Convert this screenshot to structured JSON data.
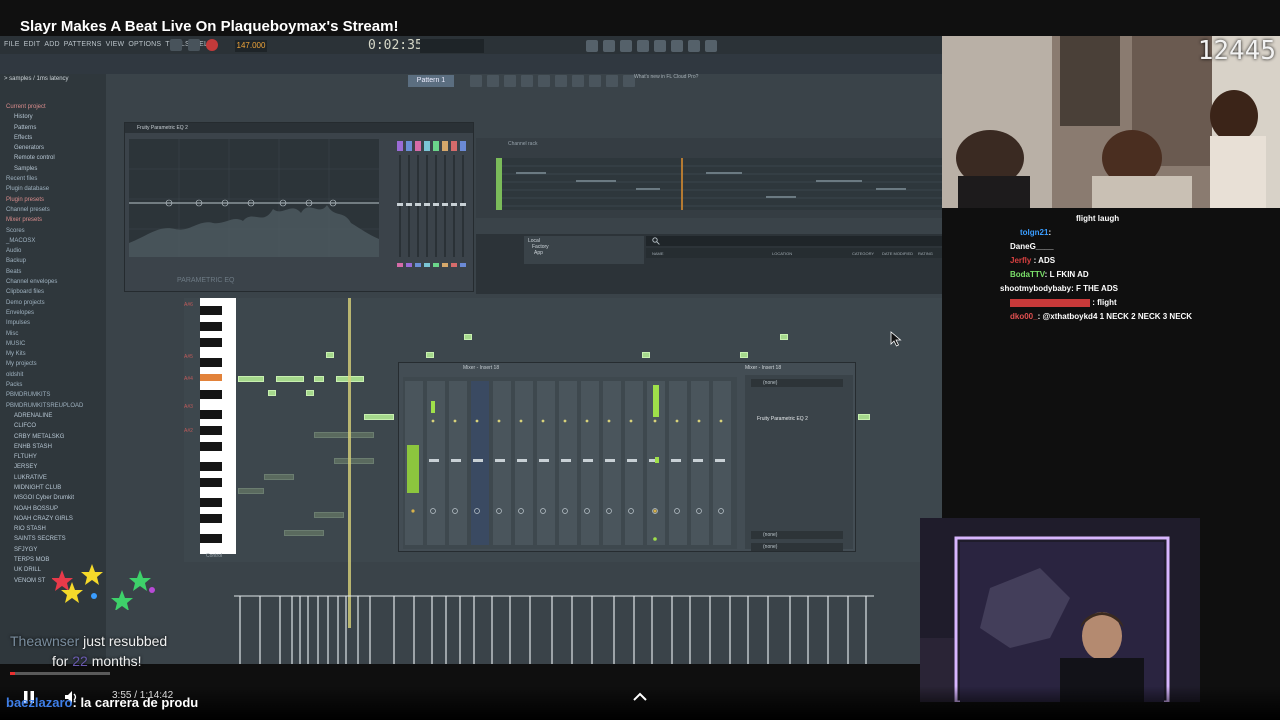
{
  "stream": {
    "title": "Slayr Makes A Beat Live On Plaqueboymax's Stream!",
    "viewer_counter": "12445"
  },
  "fl_studio": {
    "menus": [
      "FILE",
      "EDIT",
      "ADD",
      "PATTERNS",
      "VIEW",
      "OPTIONS",
      "TOOLS",
      "HELP"
    ],
    "time_display": "0:02:35",
    "tempo": "147.000",
    "pattern": "Pattern 1",
    "hint_text": "What's new in FL Cloud Pro?",
    "browser_header": "> samples / 1ms latency",
    "browser_items": [
      {
        "label": "Current project",
        "kind": "red"
      },
      {
        "label": "History",
        "kind": "sub"
      },
      {
        "label": "Patterns",
        "kind": "sub"
      },
      {
        "label": "Effects",
        "kind": "sub"
      },
      {
        "label": "Generators",
        "kind": "sub"
      },
      {
        "label": "Remote control",
        "kind": "sub"
      },
      {
        "label": "Samples",
        "kind": "sub"
      },
      {
        "label": "Recent files",
        "kind": "normal"
      },
      {
        "label": "Plugin database",
        "kind": "normal"
      },
      {
        "label": "Plugin presets",
        "kind": "red"
      },
      {
        "label": "Channel presets",
        "kind": "normal"
      },
      {
        "label": "Mixer presets",
        "kind": "red"
      },
      {
        "label": "Scores",
        "kind": "normal"
      },
      {
        "label": "_MACOSX",
        "kind": "normal"
      },
      {
        "label": "Audio",
        "kind": "normal"
      },
      {
        "label": "Backup",
        "kind": "normal"
      },
      {
        "label": "Beats",
        "kind": "normal"
      },
      {
        "label": "Channel envelopes",
        "kind": "normal"
      },
      {
        "label": "Clipboard files",
        "kind": "normal"
      },
      {
        "label": "Demo projects",
        "kind": "normal"
      },
      {
        "label": "Envelopes",
        "kind": "normal"
      },
      {
        "label": "Impulses",
        "kind": "normal"
      },
      {
        "label": "Misc",
        "kind": "normal"
      },
      {
        "label": "MUSIC",
        "kind": "normal"
      },
      {
        "label": "My Kits",
        "kind": "normal"
      },
      {
        "label": "My projects",
        "kind": "normal"
      },
      {
        "label": "oldshit",
        "kind": "normal"
      },
      {
        "label": "Packs",
        "kind": "normal"
      },
      {
        "label": "PBMDRUMKITS",
        "kind": "normal"
      },
      {
        "label": "PBMDRUMKITSREUPLOAD",
        "kind": "normal"
      },
      {
        "label": "ADRENALINE",
        "kind": "sub"
      },
      {
        "label": "CLIFCO",
        "kind": "sub"
      },
      {
        "label": "CRBY METALSKG",
        "kind": "sub"
      },
      {
        "label": "ENHB STASH",
        "kind": "sub"
      },
      {
        "label": "FLTUHY",
        "kind": "sub"
      },
      {
        "label": "JERSEY",
        "kind": "sub"
      },
      {
        "label": "LUKRATIVE",
        "kind": "sub"
      },
      {
        "label": "MIDNIGHT CLUB",
        "kind": "sub"
      },
      {
        "label": "MSGOI Cyber Drumkit",
        "kind": "sub"
      },
      {
        "label": "NOAH BOSSUP",
        "kind": "sub"
      },
      {
        "label": "NOAH CRAZY GIRLS",
        "kind": "sub"
      },
      {
        "label": "RIO STASH",
        "kind": "sub"
      },
      {
        "label": "SAINTS SECRETS",
        "kind": "sub"
      },
      {
        "label": "SFJYGY",
        "kind": "sub"
      },
      {
        "label": "TERPS MOB",
        "kind": "sub"
      },
      {
        "label": "UK DRILL",
        "kind": "sub"
      },
      {
        "label": "VENOM ST",
        "kind": "sub"
      }
    ],
    "eq_title": "Fruity Parametric EQ 2",
    "eq_label": "PARAMETRIC EQ",
    "channel_rack_title": "Channel rack",
    "browser_pane": {
      "tree": [
        "Local",
        "Factory",
        "App"
      ],
      "columns": [
        "NAME",
        "LOCATION",
        "CATEGORY",
        "DATE MODIFIED",
        "RATING"
      ]
    },
    "piano_labels": [
      "A#6",
      "A#5",
      "A#4",
      "A#3",
      "A#2"
    ],
    "control_label": "Control",
    "mixer": {
      "tab_name": "Mixer - Insert 18",
      "header": "Mixer - Insert 18",
      "insert_none": "(none)",
      "insert_plugin": "Fruity Parametric EQ 2",
      "footer_none": "(none)"
    }
  },
  "chat": [
    {
      "user": "",
      "message": "flight laugh",
      "user_color": "#ffffff"
    },
    {
      "user": "tolgn21",
      "message": "",
      "user_color": "#3a9dff"
    },
    {
      "user": "DaneG____",
      "message": "",
      "user_color": "#ffffff"
    },
    {
      "user": "Jerfly",
      "message": "ADS",
      "user_color": "#d94040"
    },
    {
      "user": "BodaTTV",
      "message": "L FKIN AD",
      "user_color": "#7be06a"
    },
    {
      "user": "shootmybodybaby",
      "message": "F THE ADS",
      "user_color": "#ffffff"
    },
    {
      "user": "",
      "message": "flight",
      "user_color": "#d94040"
    },
    {
      "user": "dko00_",
      "message": "@xthatboykd4 1 NECK 2 NECK 3 NECK",
      "user_color": "#e05050"
    }
  ],
  "resub": {
    "name": "Theawnser",
    "line1": "just resubbed",
    "line2_prefix": "for",
    "months": "22",
    "line2_suffix": "months!"
  },
  "player": {
    "time": "3:55 / 1:14:42",
    "progress": 0.05,
    "accent": "#e83030"
  },
  "bottom_chat": {
    "user": "baezlazaro",
    "message": "la carrera de produ"
  }
}
